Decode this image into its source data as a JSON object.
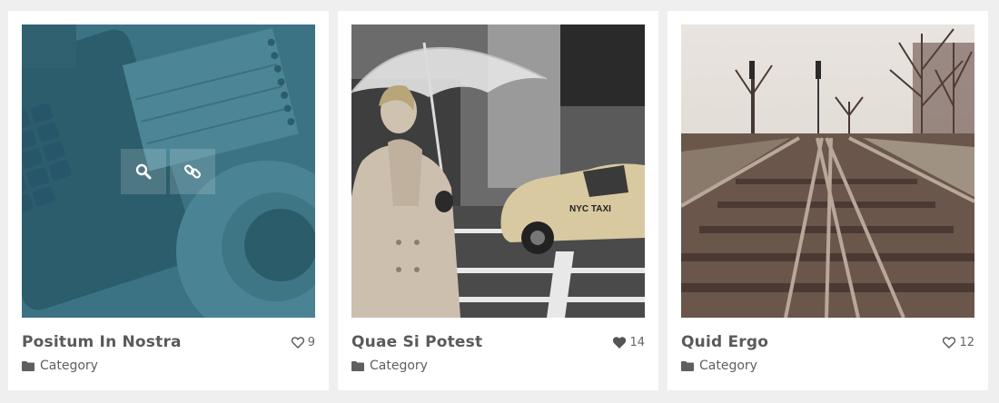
{
  "cards": [
    {
      "title": "Positum In Nostra",
      "likes": "9",
      "liked": false,
      "category": "Category",
      "overlay": {
        "tint": "#3a7080",
        "buttons": [
          "search-icon",
          "link-icon"
        ]
      }
    },
    {
      "title": "Quae Si Potest",
      "likes": "14",
      "liked": true,
      "category": "Category",
      "taxi_sign": "NYC TAXI"
    },
    {
      "title": "Quid Ergo",
      "likes": "12",
      "liked": false,
      "category": "Category"
    }
  ],
  "colors": {
    "page_bg": "#efefef",
    "card_bg": "#ffffff",
    "title": "#5a5a5a",
    "overlay_tint": "#3a7080"
  }
}
